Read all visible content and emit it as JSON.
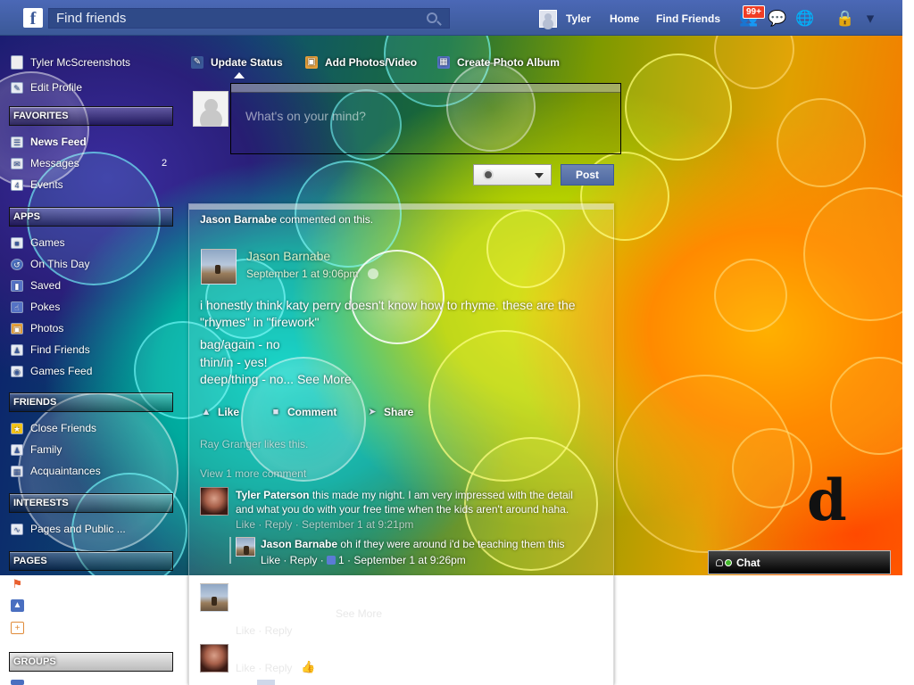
{
  "topbar": {
    "search_text": "Find friends",
    "user": "Tyler",
    "home": "Home",
    "find_friends": "Find Friends",
    "notif_badge": "99+"
  },
  "sidebar": {
    "profile_name": "Tyler McScreenshots",
    "edit_profile": "Edit Profile",
    "favorites_header": "FAVORITES",
    "favorites": [
      {
        "label": "News Feed",
        "count": ""
      },
      {
        "label": "Messages",
        "count": "2"
      },
      {
        "label": "Events",
        "count": "",
        "icon_text": "4"
      }
    ],
    "apps_header": "APPS",
    "apps": [
      "Games",
      "On This Day",
      "Saved",
      "Pokes",
      "Photos",
      "Find Friends",
      "Games Feed"
    ],
    "friends_header": "FRIENDS",
    "friends": [
      "Close Friends",
      "Family",
      "Acquaintances"
    ],
    "interests_header": "INTERESTS",
    "interests": [
      "Pages and Public ..."
    ],
    "pages_header": "PAGES",
    "groups_header": "GROUPS"
  },
  "composer": {
    "update_status": "Update Status",
    "add_photos": "Add Photos/Video",
    "create_album": "Create Photo Album",
    "placeholder": "What's on your mind?",
    "post": "Post"
  },
  "story": {
    "header_name": "Jason Barnabe",
    "header_action": "commented on this.",
    "author": "Jason Barnabe",
    "timestamp": "September 1 at 9:06pm",
    "text_line1": "i honestly think katy perry doesn't know how to rhyme. these are the",
    "text_line2": "\"rhymes\" in \"firework\"",
    "text_line3": "bag/again - no",
    "text_line4": "thin/in - yes!",
    "text_line5": "deep/thing - no...",
    "see_more": "See More",
    "like": "Like",
    "comment": "Comment",
    "share": "Share",
    "likes_line": "Ray Granger likes this.",
    "view_more": "View 1 more comment",
    "comments": [
      {
        "name": "Tyler Paterson",
        "text1": "this made my night. I am very impressed with the detail",
        "text2": "and what you do with your free time when the kids aren't around haha.",
        "meta": "Like · Reply · September 1 at 9:21pm"
      },
      {
        "name": "Jason Barnabe",
        "text1": "oh if they were around i'd be teaching them this",
        "meta_prefix": "Like · Reply · ",
        "likes": "1",
        "meta_suffix": " · September 1 at 9:26pm"
      }
    ],
    "lower_see_more": "See More",
    "lower_meta1": "Like · Reply",
    "lower_meta2": "Like · Reply"
  },
  "chat": {
    "label": "Chat"
  },
  "colors": {
    "topbar": "#3b5998",
    "post_button": "#4e69a2",
    "badge": "#f03d25"
  }
}
